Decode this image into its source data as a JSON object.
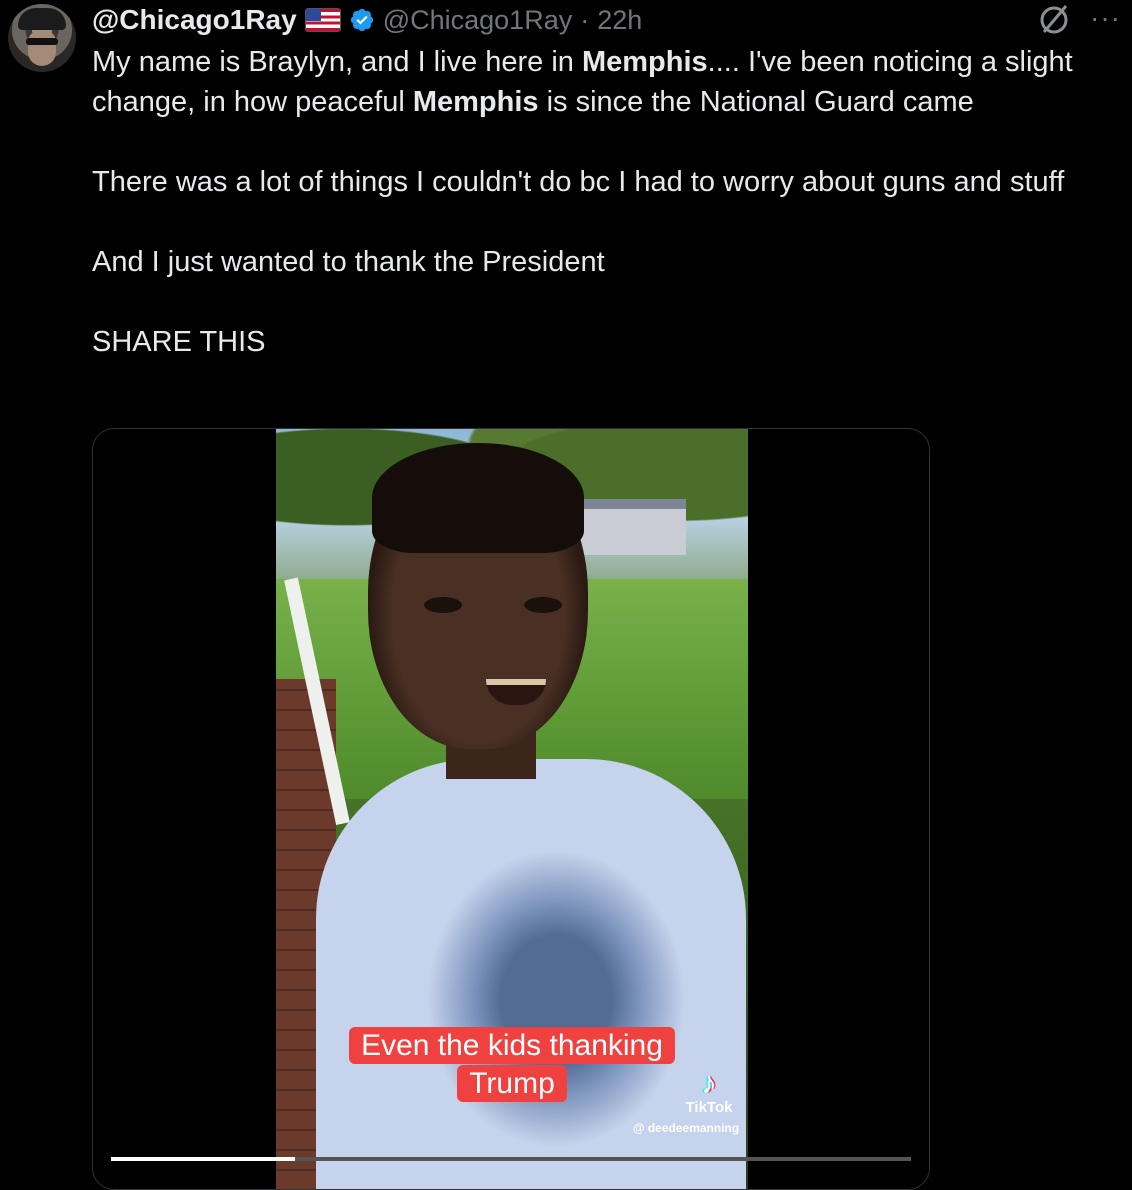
{
  "author": {
    "display_name": "@Chicago1Ray",
    "handle": "@Chicago1Ray",
    "separator": "·",
    "time": "22h",
    "verified_color": "#1d9bf0"
  },
  "icons": {
    "flag": "us-flag-icon",
    "verified": "verified-badge-icon",
    "grok": "grok-icon",
    "more": "more-options-icon",
    "more_glyph": "···"
  },
  "tweet": {
    "line1_a": "My name is Braylyn, and I live here in ",
    "line1_b": "Memphis",
    "line1_c": ".... I've been noticing a slight change, in how peaceful ",
    "line1_d": "Memphis",
    "line1_e": " is since the National Guard came",
    "para2": "There was a lot of things I couldn't do bc I had to worry about guns and stuff",
    "para3": "And I just wanted to thank the President",
    "para4": "SHARE THIS"
  },
  "video": {
    "caption": "Even the kids thanking Trump",
    "watermark": "TikTok",
    "watermark_user": "@ deedeemanning",
    "progress": 0.23
  }
}
